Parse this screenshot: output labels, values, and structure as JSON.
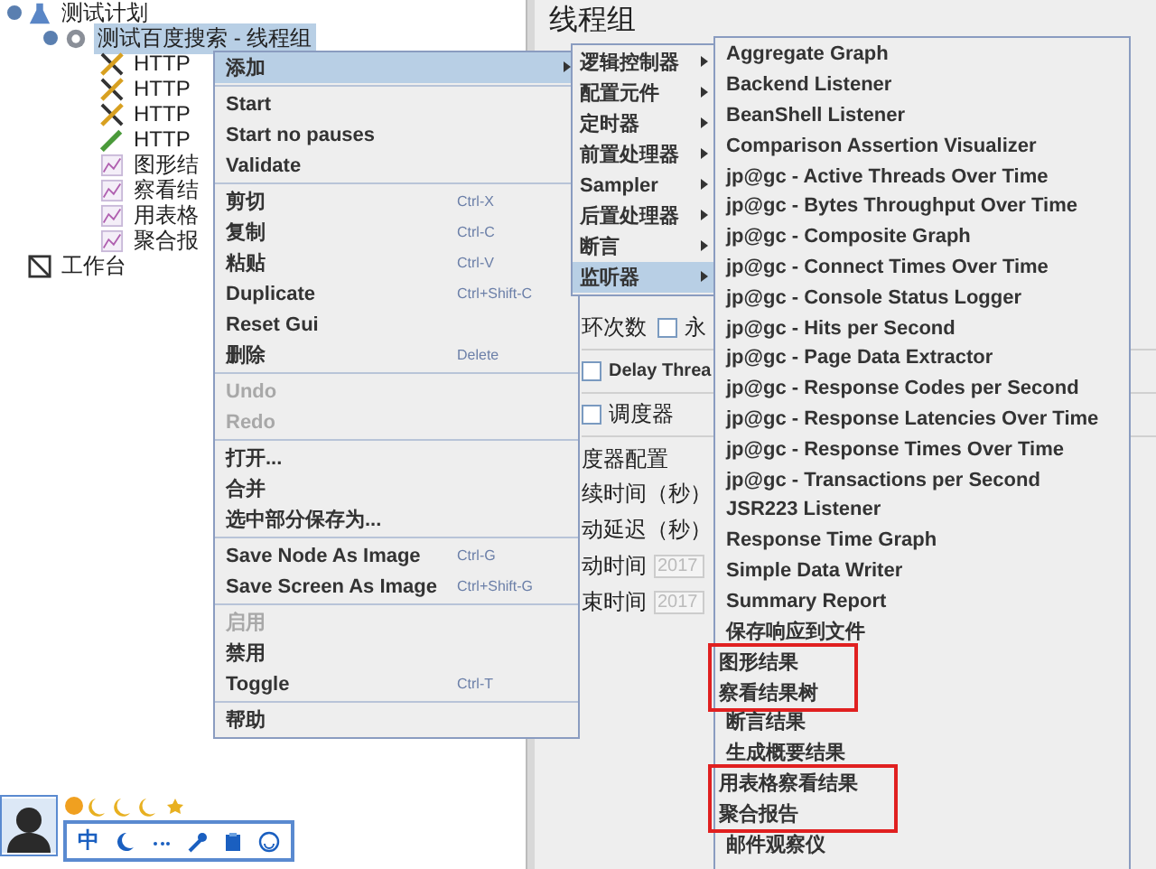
{
  "tree": [
    {
      "label": "测试计划",
      "kind": "plan",
      "expanded": true,
      "selected": false,
      "children": [
        {
          "label": "测试百度搜索 - 线程组",
          "kind": "thread-group",
          "expanded": true,
          "selected": true,
          "children": [
            {
              "label": "HTTP",
              "kind": "config",
              "selected": false
            },
            {
              "label": "HTTP",
              "kind": "config",
              "selected": false
            },
            {
              "label": "HTTP",
              "kind": "config",
              "selected": false
            },
            {
              "label": "HTTP",
              "kind": "sampler",
              "selected": false
            },
            {
              "label": "图形结",
              "kind": "listener",
              "selected": false
            },
            {
              "label": "察看结",
              "kind": "listener",
              "selected": false
            },
            {
              "label": "用表格",
              "kind": "listener",
              "selected": false
            },
            {
              "label": "聚合报",
              "kind": "listener",
              "selected": false
            }
          ]
        }
      ]
    },
    {
      "label": "工作台",
      "kind": "workbench",
      "selected": false
    }
  ],
  "panel": {
    "title": "线程组",
    "loop_label": "环次数",
    "forever_checkbox": {
      "label": "永",
      "checked": false
    },
    "delay_checkbox": {
      "label": "Delay Threa",
      "checked": false
    },
    "scheduler_checkbox": {
      "label": "调度器",
      "checked": false
    },
    "scheduler_config": {
      "title": "度器配置",
      "fields": [
        {
          "label": "续时间（秒）"
        },
        {
          "label": "动延迟（秒）"
        },
        {
          "label": "动时间",
          "value": "2017"
        },
        {
          "label": "束时间",
          "value": "2017"
        }
      ]
    }
  },
  "context_menu": {
    "groups": [
      [
        {
          "label": "添加",
          "has_submenu": true,
          "selected": true,
          "disabled": false
        }
      ],
      [
        {
          "label": "Start",
          "has_submenu": false,
          "selected": false,
          "disabled": false
        },
        {
          "label": "Start no pauses",
          "has_submenu": false,
          "selected": false,
          "disabled": false
        },
        {
          "label": "Validate",
          "has_submenu": false,
          "selected": false,
          "disabled": false
        }
      ],
      [
        {
          "label": "剪切",
          "shortcut": "Ctrl-X",
          "has_submenu": false,
          "selected": false,
          "disabled": false
        },
        {
          "label": "复制",
          "shortcut": "Ctrl-C",
          "has_submenu": false,
          "selected": false,
          "disabled": false
        },
        {
          "label": "粘贴",
          "shortcut": "Ctrl-V",
          "has_submenu": false,
          "selected": false,
          "disabled": false
        },
        {
          "label": "Duplicate",
          "shortcut": "Ctrl+Shift-C",
          "has_submenu": false,
          "selected": false,
          "disabled": false
        },
        {
          "label": "Reset Gui",
          "has_submenu": false,
          "selected": false,
          "disabled": false
        },
        {
          "label": "删除",
          "shortcut": "Delete",
          "has_submenu": false,
          "selected": false,
          "disabled": false
        }
      ],
      [
        {
          "label": "Undo",
          "has_submenu": false,
          "selected": false,
          "disabled": true
        },
        {
          "label": "Redo",
          "has_submenu": false,
          "selected": false,
          "disabled": true
        }
      ],
      [
        {
          "label": "打开...",
          "has_submenu": false,
          "selected": false,
          "disabled": false
        },
        {
          "label": "合并",
          "has_submenu": false,
          "selected": false,
          "disabled": false
        },
        {
          "label": "选中部分保存为...",
          "has_submenu": false,
          "selected": false,
          "disabled": false
        }
      ],
      [
        {
          "label": "Save Node As Image",
          "shortcut": "Ctrl-G",
          "has_submenu": false,
          "selected": false,
          "disabled": false
        },
        {
          "label": "Save Screen As Image",
          "shortcut": "Ctrl+Shift-G",
          "has_submenu": false,
          "selected": false,
          "disabled": false
        }
      ],
      [
        {
          "label": "启用",
          "has_submenu": false,
          "selected": false,
          "disabled": true
        },
        {
          "label": "禁用",
          "has_submenu": false,
          "selected": false,
          "disabled": false
        },
        {
          "label": "Toggle",
          "shortcut": "Ctrl-T",
          "has_submenu": false,
          "selected": false,
          "disabled": false
        }
      ],
      [
        {
          "label": "帮助",
          "has_submenu": false,
          "selected": false,
          "disabled": false
        }
      ]
    ]
  },
  "add_submenu": [
    {
      "label": "逻辑控制器",
      "selected": false
    },
    {
      "label": "配置元件",
      "selected": false
    },
    {
      "label": "定时器",
      "selected": false
    },
    {
      "label": "前置处理器",
      "selected": false
    },
    {
      "label": "Sampler",
      "selected": false
    },
    {
      "label": "后置处理器",
      "selected": false
    },
    {
      "label": "断言",
      "selected": false
    },
    {
      "label": "监听器",
      "selected": true
    }
  ],
  "listener_submenu": [
    {
      "boxed": false,
      "items": [
        {
          "label": "Aggregate Graph",
          "selected": false
        },
        {
          "label": "Backend Listener",
          "selected": false
        },
        {
          "label": "BeanShell Listener",
          "selected": false
        },
        {
          "label": "Comparison Assertion Visualizer",
          "selected": false
        },
        {
          "label": "jp@gc - Active Threads Over Time",
          "selected": false
        },
        {
          "label": "jp@gc - Bytes Throughput Over Time",
          "selected": false
        },
        {
          "label": "jp@gc - Composite Graph",
          "selected": false
        },
        {
          "label": "jp@gc - Connect Times Over Time",
          "selected": false
        },
        {
          "label": "jp@gc - Console Status Logger",
          "selected": false
        },
        {
          "label": "jp@gc - Hits per Second",
          "selected": false
        },
        {
          "label": "jp@gc - Page Data Extractor",
          "selected": false
        },
        {
          "label": "jp@gc - Response Codes per Second",
          "selected": false
        },
        {
          "label": "jp@gc - Response Latencies Over Time",
          "selected": false
        },
        {
          "label": "jp@gc - Response Times Over Time",
          "selected": false
        },
        {
          "label": "jp@gc - Transactions per Second",
          "selected": false
        },
        {
          "label": "JSR223 Listener",
          "selected": false
        },
        {
          "label": "Response Time Graph",
          "selected": false
        },
        {
          "label": "Simple Data Writer",
          "selected": false
        },
        {
          "label": "Summary Report",
          "selected": false
        },
        {
          "label": "保存响应到文件",
          "selected": false
        }
      ]
    },
    {
      "boxed": true,
      "items": [
        {
          "label": "图形结果",
          "selected": false
        },
        {
          "label": "察看结果树",
          "selected": false
        }
      ]
    },
    {
      "boxed": false,
      "items": [
        {
          "label": "断言结果",
          "selected": false
        },
        {
          "label": "生成概要结果",
          "selected": false
        }
      ]
    },
    {
      "boxed": true,
      "items": [
        {
          "label": "用表格察看结果",
          "selected": false
        },
        {
          "label": "聚合报告",
          "selected": false
        }
      ]
    },
    {
      "boxed": false,
      "items": [
        {
          "label": "邮件观察仪",
          "selected": false
        }
      ]
    }
  ],
  "ime_toolbar": {
    "mode_label": "中"
  }
}
